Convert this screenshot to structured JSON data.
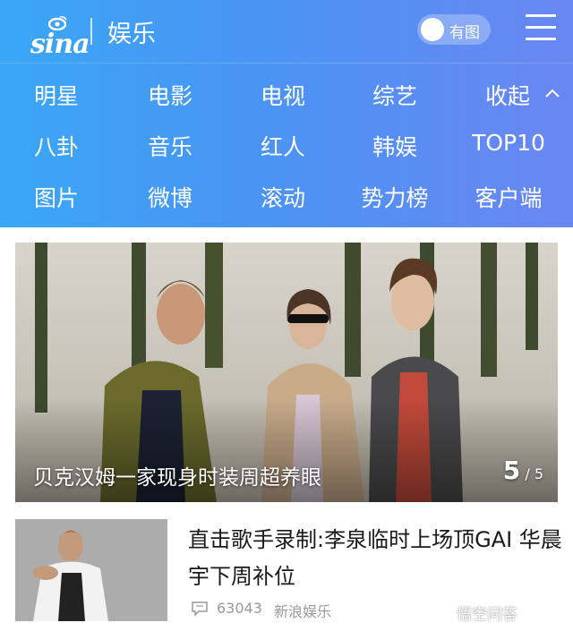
{
  "header": {
    "logo_text": "sina",
    "section_title": "娱乐",
    "image_toggle_label": "有图"
  },
  "nav": {
    "items": [
      "明星",
      "电影",
      "电视",
      "综艺",
      "收起",
      "八卦",
      "音乐",
      "红人",
      "韩娱",
      "TOP10",
      "图片",
      "微博",
      "滚动",
      "势力榜",
      "客户端"
    ]
  },
  "feature": {
    "caption": "贝克汉姆一家现身时装周超养眼",
    "current": "5",
    "total": "/ 5"
  },
  "news": [
    {
      "headline": "直击歌手录制:李泉临时上场顶GAI 华晨宇下周补位",
      "comment_count": "63043",
      "source": "新浪娱乐"
    }
  ],
  "watermark": "悟空问答",
  "colors": {
    "header_gradient_start": "#3aa7f5",
    "header_gradient_end": "#6a86f1",
    "headline_text": "#1a1a1a",
    "meta_text": "#9a9a9a"
  },
  "icons": [
    "sina-eye-icon",
    "toggle-knob",
    "menu-icon",
    "chevron-up-icon",
    "comment-icon"
  ]
}
